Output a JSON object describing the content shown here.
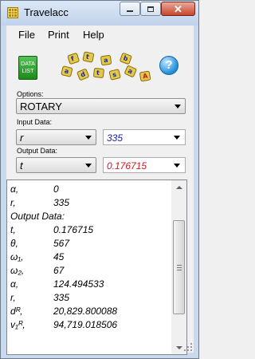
{
  "window": {
    "title": "Travelacc"
  },
  "menu": [
    "File",
    "Print",
    "Help"
  ],
  "toolbar": {
    "data_list_line1": "DATA",
    "data_list_line2": "LIST",
    "help_glyph": "?"
  },
  "options": {
    "label": "Options:",
    "selected": "ROTARY"
  },
  "input": {
    "label": "Input Data:",
    "selected": "r",
    "value": "335",
    "value_color": "#1a1ab8"
  },
  "output_data": {
    "label": "Output Data:",
    "selected": "t",
    "value": "0.176715",
    "value_color": "#d4141c"
  },
  "results": [
    {
      "k": "α,",
      "v": "0"
    },
    {
      "k": "r,",
      "v": "335"
    },
    {
      "k": "Output Data:",
      "v": ""
    },
    {
      "k": "t,",
      "v": "0.176715"
    },
    {
      "k": "θ,",
      "v": "567"
    },
    {
      "k": "ω₁,",
      "v": "45"
    },
    {
      "k": "ω₂,",
      "v": "67"
    },
    {
      "k": "α,",
      "v": "124.494533"
    },
    {
      "k": "r,",
      "v": "335"
    },
    {
      "k": "dᴿ,",
      "v": "20,829.800088"
    },
    {
      "k": "v₁ᴿ,",
      "v": "94,719.018506"
    }
  ]
}
